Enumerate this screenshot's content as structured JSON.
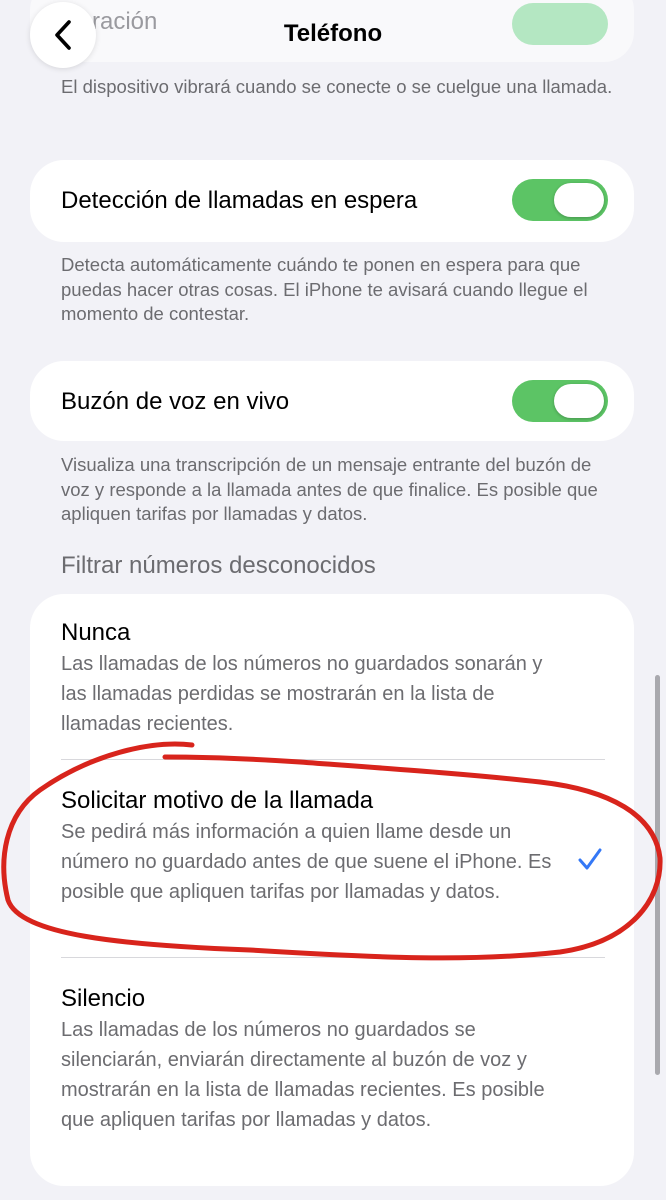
{
  "nav": {
    "title": "Teléfono",
    "back_icon": "chevron-left-icon",
    "partial_label": "ración"
  },
  "vibration_footnote": "El dispositivo vibrará cuando se conecte o se cuelgue una llamada.",
  "hold_detection": {
    "label": "Detección de llamadas en espera",
    "enabled": true,
    "footnote": "Detecta automáticamente cuándo te ponen en espera para que puedas hacer otras cosas. El iPhone te avisará cuando llegue el momento de contestar."
  },
  "live_voicemail": {
    "label": "Buzón de voz en vivo",
    "enabled": true,
    "footnote": "Visualiza una transcripción de un mensaje entrante del buzón de voz y responde a la llamada antes de que finalice. Es posible que apliquen tarifas por llamadas y datos."
  },
  "screen_unknown": {
    "header": "Filtrar números desconocidos",
    "options": [
      {
        "title": "Nunca",
        "description": "Las llamadas de los números no guardados sonarán y las llamadas perdidas se mostrarán en la lista de llamadas recientes.",
        "selected": false
      },
      {
        "title": "Solicitar motivo de la llamada",
        "description": "Se pedirá más información a quien llame desde un número no guardado antes de que suene el iPhone. Es posible que apliquen tarifas por llamadas y datos.",
        "selected": true
      },
      {
        "title": "Silencio",
        "description": "Las llamadas de los números no guardados se silenciarán, enviarán directamente al buzón de voz y mostrarán en la lista de llamadas recientes. Es posible que apliquen tarifas por llamadas y datos.",
        "selected": false
      }
    ]
  },
  "colors": {
    "toggle_on": "#5cc465",
    "checkmark": "#3478f6",
    "annotation": "#d8241c",
    "background": "#f2f2f7"
  }
}
